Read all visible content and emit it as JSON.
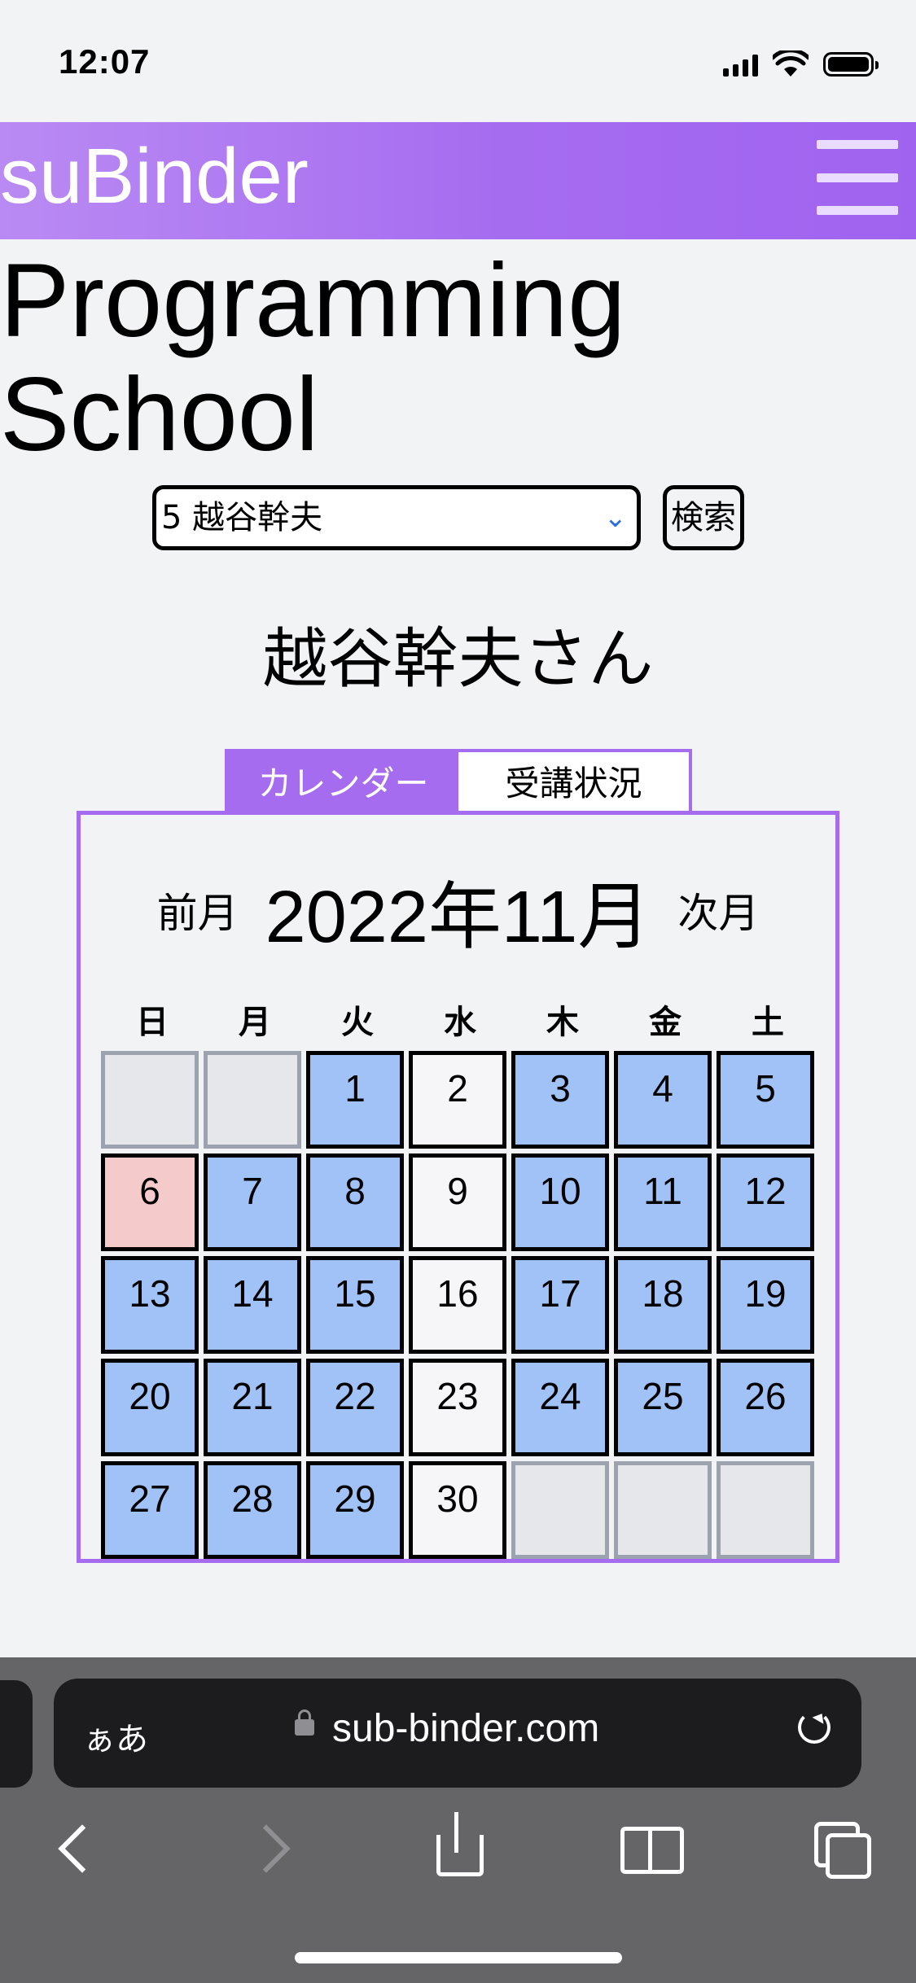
{
  "status_bar": {
    "time": "12:07"
  },
  "header": {
    "brand": "suBinder"
  },
  "school_title": "Programming School",
  "selector": {
    "value": "5 越谷幹夫",
    "search_label": "検索"
  },
  "user_name": "越谷幹夫さん",
  "tabs": [
    {
      "label": "カレンダー"
    },
    {
      "label": "受講状況"
    }
  ],
  "calendar": {
    "prev_label": "前月",
    "month": "2022年11月",
    "next_label": "次月",
    "weekdays": [
      "日",
      "月",
      "火",
      "水",
      "木",
      "金",
      "土"
    ],
    "weeks": [
      [
        {
          "d": "",
          "s": "empty"
        },
        {
          "d": "",
          "s": "empty"
        },
        {
          "d": "1",
          "s": "blue"
        },
        {
          "d": "2",
          "s": "white"
        },
        {
          "d": "3",
          "s": "blue"
        },
        {
          "d": "4",
          "s": "blue"
        },
        {
          "d": "5",
          "s": "blue"
        }
      ],
      [
        {
          "d": "6",
          "s": "red"
        },
        {
          "d": "7",
          "s": "blue"
        },
        {
          "d": "8",
          "s": "blue"
        },
        {
          "d": "9",
          "s": "white"
        },
        {
          "d": "10",
          "s": "blue"
        },
        {
          "d": "11",
          "s": "blue"
        },
        {
          "d": "12",
          "s": "blue"
        }
      ],
      [
        {
          "d": "13",
          "s": "blue"
        },
        {
          "d": "14",
          "s": "blue"
        },
        {
          "d": "15",
          "s": "blue"
        },
        {
          "d": "16",
          "s": "white"
        },
        {
          "d": "17",
          "s": "blue"
        },
        {
          "d": "18",
          "s": "blue"
        },
        {
          "d": "19",
          "s": "blue"
        }
      ],
      [
        {
          "d": "20",
          "s": "blue"
        },
        {
          "d": "21",
          "s": "blue"
        },
        {
          "d": "22",
          "s": "blue"
        },
        {
          "d": "23",
          "s": "white"
        },
        {
          "d": "24",
          "s": "blue"
        },
        {
          "d": "25",
          "s": "blue"
        },
        {
          "d": "26",
          "s": "blue"
        }
      ],
      [
        {
          "d": "27",
          "s": "blue"
        },
        {
          "d": "28",
          "s": "blue"
        },
        {
          "d": "29",
          "s": "blue"
        },
        {
          "d": "30",
          "s": "white"
        },
        {
          "d": "",
          "s": "empty"
        },
        {
          "d": "",
          "s": "empty"
        },
        {
          "d": "",
          "s": "empty"
        }
      ]
    ]
  },
  "browser": {
    "aa_label": "ぁあ",
    "url": "sub-binder.com"
  },
  "colors": {
    "accent": "#a66cf0",
    "day_blue": "#a1c2f7",
    "day_red": "#f4caca",
    "day_white": "#f6f6f8",
    "empty": "#e5e7eb"
  }
}
